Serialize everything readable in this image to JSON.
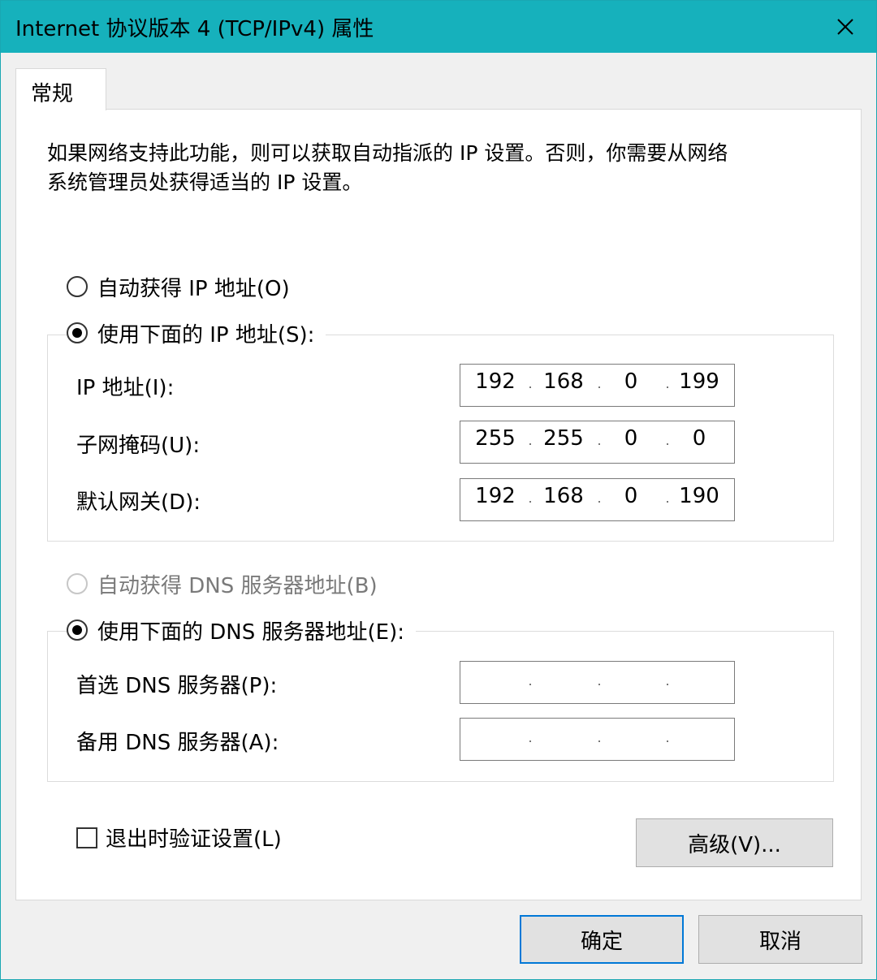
{
  "window": {
    "title": "Internet 协议版本 4 (TCP/IPv4) 属性",
    "accent_color": "#16b1bc",
    "close_icon": "close-icon"
  },
  "tabs": [
    {
      "label": "常规",
      "selected": true
    }
  ],
  "description": {
    "line1": "如果网络支持此功能，则可以获取自动指派的 IP 设置。否则，你需要从网络",
    "line2": "系统管理员处获得适当的 IP 设置。"
  },
  "ip_section": {
    "auto_radio": {
      "label": "自动获得 IP 地址(O)",
      "checked": false
    },
    "manual_radio": {
      "label": "使用下面的 IP 地址(S):",
      "checked": true
    },
    "fields": [
      {
        "label": "IP 地址(I):",
        "octets": [
          "192",
          "168",
          "0",
          "199"
        ]
      },
      {
        "label": "子网掩码(U):",
        "octets": [
          "255",
          "255",
          "0",
          "0"
        ]
      },
      {
        "label": "默认网关(D):",
        "octets": [
          "192",
          "168",
          "0",
          "190"
        ]
      }
    ]
  },
  "dns_section": {
    "auto_radio": {
      "label": "自动获得 DNS 服务器地址(B)",
      "checked": false,
      "disabled": true
    },
    "manual_radio": {
      "label": "使用下面的 DNS 服务器地址(E):",
      "checked": true
    },
    "fields": [
      {
        "label": "首选 DNS 服务器(P):",
        "octets": [
          "",
          "",
          "",
          ""
        ]
      },
      {
        "label": "备用 DNS 服务器(A):",
        "octets": [
          "",
          "",
          "",
          ""
        ]
      }
    ]
  },
  "validate_checkbox": {
    "label": "退出时验证设置(L)",
    "checked": false
  },
  "buttons": {
    "advanced": "高级(V)...",
    "ok": "确定",
    "cancel": "取消"
  }
}
